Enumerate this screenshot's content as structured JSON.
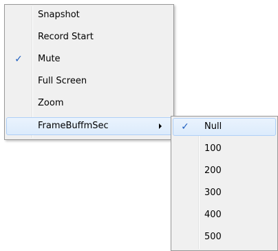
{
  "main_menu": {
    "items": [
      {
        "label": "Snapshot",
        "checked": false
      },
      {
        "label": "Record Start",
        "checked": false
      },
      {
        "label": "Mute",
        "checked": true
      },
      {
        "label": "Full Screen",
        "checked": false
      },
      {
        "label": "Zoom",
        "checked": false
      },
      {
        "label": "FrameBuffmSec",
        "checked": false,
        "has_submenu": true,
        "highlighted": true
      }
    ]
  },
  "sub_menu": {
    "items": [
      {
        "label": "Null",
        "checked": true,
        "highlighted": true
      },
      {
        "label": "100",
        "checked": false
      },
      {
        "label": "200",
        "checked": false
      },
      {
        "label": "300",
        "checked": false
      },
      {
        "label": "400",
        "checked": false
      },
      {
        "label": "500",
        "checked": false
      }
    ]
  },
  "icons": {
    "check": "checkmark-icon",
    "submenu": "submenu-arrow-icon"
  },
  "colors": {
    "menu_background": "#f0f0f0",
    "menu_border": "#979797",
    "highlight_border": "#aecff7",
    "check_color": "#1f5fbf"
  }
}
